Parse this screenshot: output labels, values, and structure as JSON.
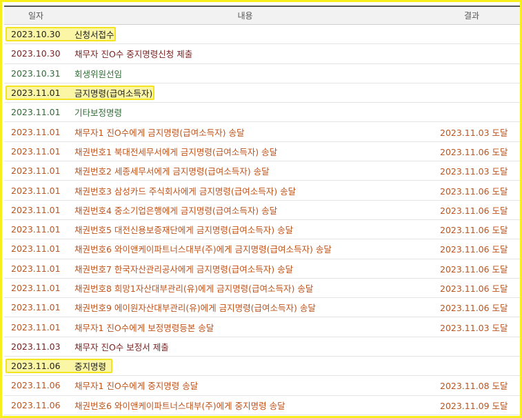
{
  "header": {
    "date": "일자",
    "content": "내용",
    "result": "결과"
  },
  "colors": {
    "orange": "#c0531a",
    "green": "#2f6d33",
    "maroon": "#7a1d1d",
    "highlight_fill": "#fbf6a6",
    "highlight_border": "#f2e51f"
  },
  "rows": [
    {
      "date": "2023.10.30",
      "content": "신청서접수",
      "result": "",
      "style": "hilite"
    },
    {
      "date": "2023.10.30",
      "content": "채무자 진O수 중지명령신청 제출",
      "result": "",
      "style": "maroon"
    },
    {
      "date": "2023.10.31",
      "content": "회생위원선임",
      "result": "",
      "style": "green"
    },
    {
      "date": "2023.11.01",
      "content": "금지명령(급여소득자)",
      "result": "",
      "style": "hilite"
    },
    {
      "date": "2023.11.01",
      "content": "기타보정명령",
      "result": "",
      "style": "green"
    },
    {
      "date": "2023.11.01",
      "content": "채무자1 진O수에게 금지명령(급여소득자) 송달",
      "result": "2023.11.03 도달",
      "style": "orange"
    },
    {
      "date": "2023.11.01",
      "content": "채권번호1 북대전세무서에게 금지명령(급여소득자) 송달",
      "result": "2023.11.06 도달",
      "style": "orange"
    },
    {
      "date": "2023.11.01",
      "content": "채권번호2 세종세무서에게 금지명령(급여소득자) 송달",
      "result": "2023.11.03 도달",
      "style": "orange"
    },
    {
      "date": "2023.11.01",
      "content": "채권번호3 삼성카드 주식회사에게 금지명령(급여소득자) 송달",
      "result": "2023.11.06 도달",
      "style": "orange"
    },
    {
      "date": "2023.11.01",
      "content": "채권번호4 중소기업은행에게 금지명령(급여소득자) 송달",
      "result": "2023.11.06 도달",
      "style": "orange"
    },
    {
      "date": "2023.11.01",
      "content": "채권번호5 대전신용보증재단에게 금지명령(급여소득자) 송달",
      "result": "2023.11.06 도달",
      "style": "orange"
    },
    {
      "date": "2023.11.01",
      "content": "채권번호6 와이앤케이파트너스대부(주)에게 금지명령(급여소득자) 송달",
      "result": "2023.11.06 도달",
      "style": "orange"
    },
    {
      "date": "2023.11.01",
      "content": "채권번호7 한국자산관리공사에게 금지명령(급여소득자) 송달",
      "result": "2023.11.06 도달",
      "style": "orange"
    },
    {
      "date": "2023.11.01",
      "content": "채권번호8 희망1자산대부관리(유)에게 금지명령(급여소득자) 송달",
      "result": "2023.11.06 도달",
      "style": "orange"
    },
    {
      "date": "2023.11.01",
      "content": "채권번호9 에이원자산대부관리(유)에게 금지명령(급여소득자) 송달",
      "result": "2023.11.06 도달",
      "style": "orange"
    },
    {
      "date": "2023.11.01",
      "content": "채무자1 진O수에게 보정명령등본 송달",
      "result": "2023.11.03 도달",
      "style": "orange"
    },
    {
      "date": "2023.11.03",
      "content": "채무자 진O수 보정서 제출",
      "result": "",
      "style": "maroon"
    },
    {
      "date": "2023.11.06",
      "content": "중지명령",
      "result": "",
      "style": "hilite"
    },
    {
      "date": "2023.11.06",
      "content": "채무자1 진O수에게 중지명령 송달",
      "result": "2023.11.08 도달",
      "style": "orange"
    },
    {
      "date": "2023.11.06",
      "content": "채권번호6 와이앤케이파트너스대부(주)에게 중지명령 송달",
      "result": "2023.11.09 도달",
      "style": "orange"
    }
  ]
}
